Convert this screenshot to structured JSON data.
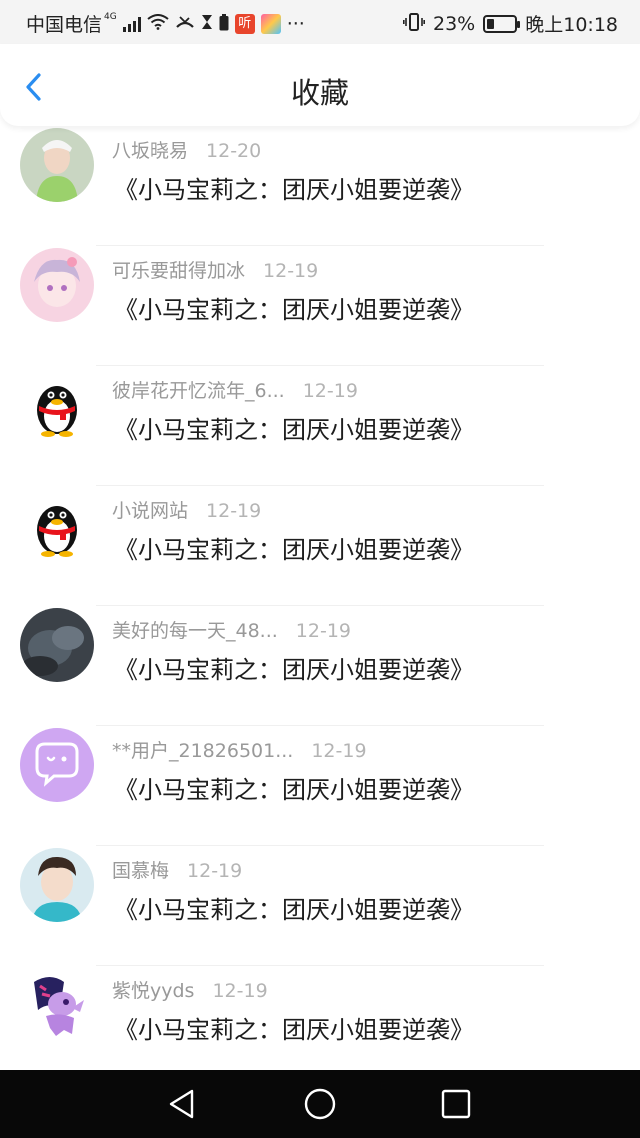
{
  "status_bar": {
    "carrier": "中国电信",
    "network": "4G",
    "app_badge_1": "听",
    "more": "···",
    "battery_percent": "23%",
    "battery_level": 0.23,
    "time": "晚上10:18"
  },
  "header": {
    "title": "收藏"
  },
  "items": [
    {
      "name": "八坂晓易",
      "date": "12-20",
      "title": "《小马宝莉之：团厌小姐要逆袭》",
      "avatar": "avatar-girl-green"
    },
    {
      "name": "可乐要甜得加冰",
      "date": "12-19",
      "title": "《小马宝莉之：团厌小姐要逆袭》",
      "avatar": "avatar-anime-pink"
    },
    {
      "name": "彼岸花开忆流年_6...",
      "date": "12-19",
      "title": "《小马宝莉之：团厌小姐要逆袭》",
      "avatar": "qq-penguin"
    },
    {
      "name": "小说网站",
      "date": "12-19",
      "title": "《小马宝莉之：团厌小姐要逆袭》",
      "avatar": "qq-penguin"
    },
    {
      "name": "美好的每一天_48...",
      "date": "12-19",
      "title": "《小马宝莉之：团厌小姐要逆袭》",
      "avatar": "avatar-dark-photo"
    },
    {
      "name": "**用户_21826501...",
      "date": "12-19",
      "title": "《小马宝莉之：团厌小姐要逆袭》",
      "avatar": "chat-bubble"
    },
    {
      "name": "国慕梅",
      "date": "12-19",
      "title": "《小马宝莉之：团厌小姐要逆袭》",
      "avatar": "avatar-boy-teal"
    },
    {
      "name": "紫悦yyds",
      "date": "12-19",
      "title": "《小马宝莉之：团厌小姐要逆袭》",
      "avatar": "pony-twilight"
    }
  ],
  "colors": {
    "accent": "#2a8df0",
    "title_text": "#1e1e1e",
    "meta_text": "#999999"
  },
  "nav_bar": {
    "back_icon": "triangle-back-icon",
    "home_icon": "circle-home-icon",
    "recents_icon": "square-recents-icon"
  }
}
